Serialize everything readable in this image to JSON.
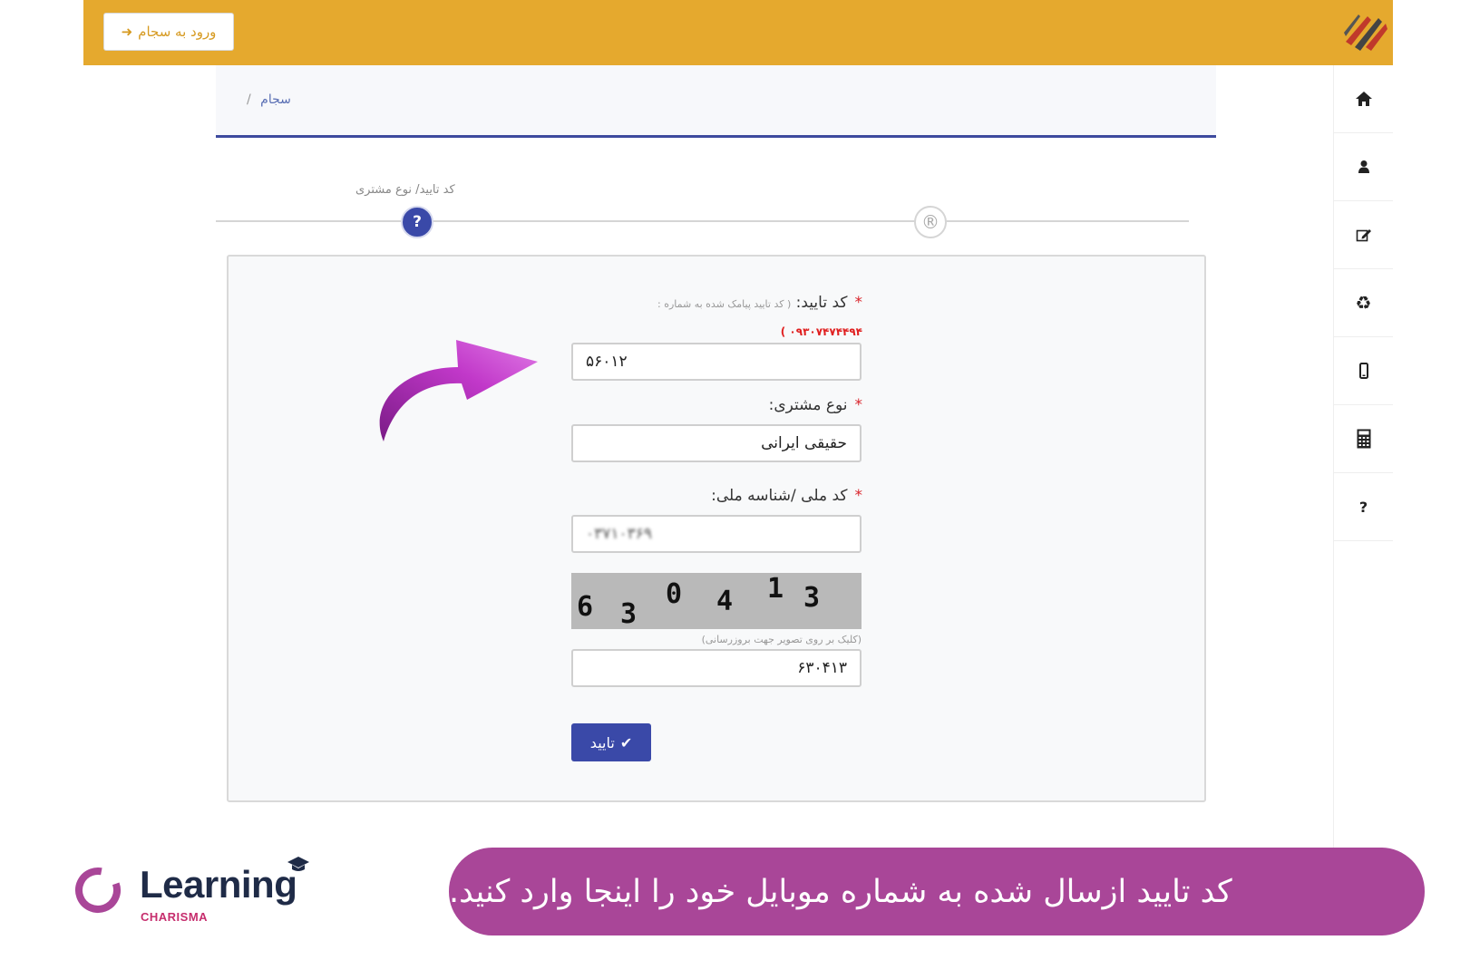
{
  "header": {
    "login_button_label": "ورود به سجام",
    "login_icon": "sign-in-icon",
    "accent_color": "#e5a92e"
  },
  "sidebar": {
    "items": [
      {
        "icon": "home-icon",
        "glyph": "⌂"
      },
      {
        "icon": "user-icon",
        "glyph": "👤"
      },
      {
        "icon": "edit-icon",
        "glyph": "✎"
      },
      {
        "icon": "recycle-icon",
        "glyph": "♻"
      },
      {
        "icon": "mobile-icon",
        "glyph": "▯"
      },
      {
        "icon": "calculator-icon",
        "glyph": "▦"
      },
      {
        "icon": "help-icon",
        "glyph": "?"
      }
    ]
  },
  "breadcrumb": {
    "item": "سجام",
    "separator": "/"
  },
  "steps": {
    "current_label": "کد تایید/ نوع مشتری",
    "current_glyph": "?",
    "next_glyph": "®"
  },
  "form": {
    "code_label": "کد تایید:",
    "code_hint": "( کد تایید پیامک شده به شماره :",
    "phone_number": "۰۹۳۰۷۴۷۴۴۹۴ )",
    "code_value": "۵۶۰۱۲",
    "customer_type_label": "نوع مشتری:",
    "customer_type_value": "حقیقی ایرانی",
    "national_id_label": "کد ملی /شناسه ملی:",
    "national_id_value": "۰۳۷۱۰۳۶۹",
    "captcha_digits": [
      "6",
      "3",
      "0",
      "4",
      "1",
      "3"
    ],
    "captcha_hint": "(کلیک بر روی تصویر جهت بروزرسانی)",
    "captcha_value": "۶۳۰۴۱۳",
    "submit_label": "تایید",
    "required_mark": "*",
    "primary_color": "#3a49a8"
  },
  "caption": {
    "text": "کد تایید ازسال شده به شماره موبایل خود را اینجا وارد کنید.",
    "color": "#a94698"
  },
  "brand": {
    "name": "Learning",
    "subtitle": "CHARISMA"
  }
}
